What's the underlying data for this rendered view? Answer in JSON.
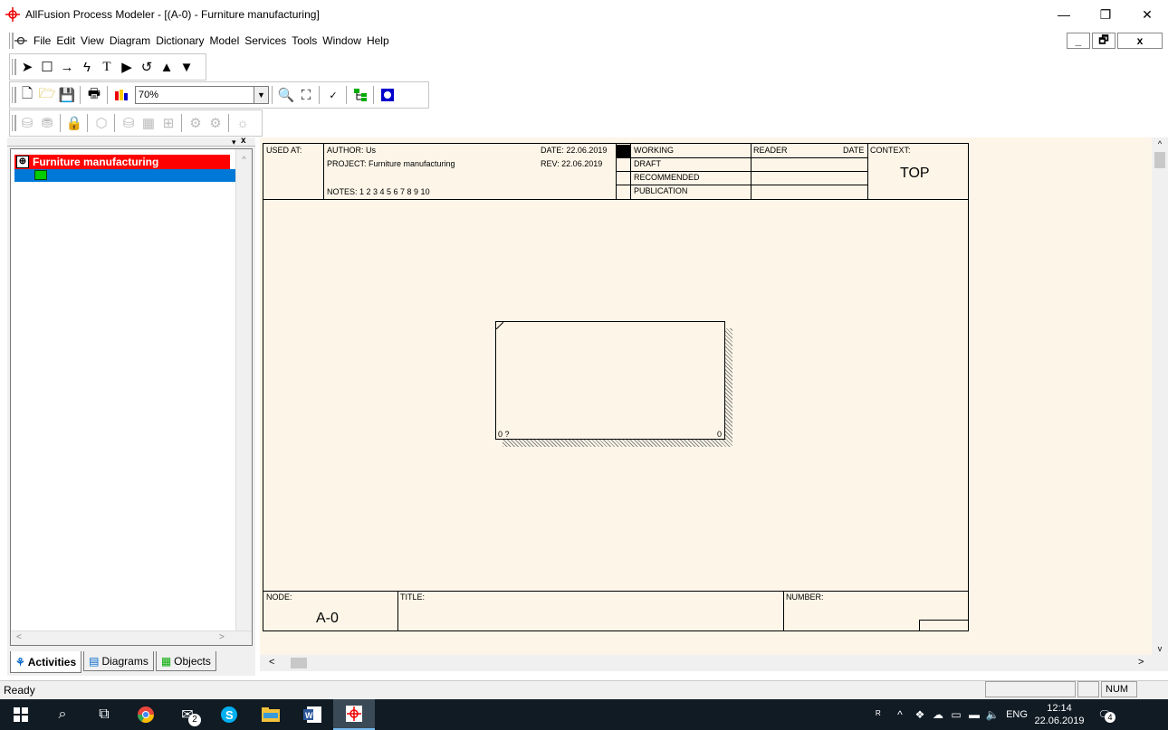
{
  "window": {
    "title": "AllFusion Process Modeler - [(A-0)  - Furniture manufacturing]",
    "minimize": "—",
    "restore": "❐",
    "close": "✕"
  },
  "menu": {
    "items": [
      "File",
      "Edit",
      "View",
      "Diagram",
      "Dictionary",
      "Model",
      "Services",
      "Tools",
      "Window",
      "Help"
    ],
    "mdi_minimize": "_",
    "mdi_restore": "🗗",
    "mdi_close": "x"
  },
  "toolbar": {
    "zoom_value": "70%"
  },
  "tree": {
    "root_label": "Furniture manufacturing"
  },
  "tabs": {
    "activities": "Activities",
    "diagrams": "Diagrams",
    "objects": "Objects"
  },
  "diagram": {
    "used_at": "USED AT:",
    "author": "AUTHOR:  Us",
    "project": "PROJECT:  Furniture manufacturing",
    "notes": "NOTES:  1  2  3  4  5  6  7  8  9  10",
    "date": "DATE:  22.06.2019",
    "rev": "REV:   22.06.2019",
    "status_working": "WORKING",
    "status_draft": "DRAFT",
    "status_recommended": "RECOMMENDED",
    "status_publication": "PUBLICATION",
    "reader": "READER",
    "reader_date": "DATE",
    "context": "CONTEXT:",
    "context_value": "TOP",
    "node_label": "NODE:",
    "node_value": "A-0",
    "title_label": "TITLE:",
    "number_label": "NUMBER:",
    "activity_cost": "0 ?",
    "activity_number": "0"
  },
  "status": {
    "text": "Ready",
    "num": "NUM"
  },
  "taskbar": {
    "badge_mail": "2",
    "tray_lang": "ENG",
    "time": "12:14",
    "date": "22.06.2019",
    "notif_count": "4"
  }
}
